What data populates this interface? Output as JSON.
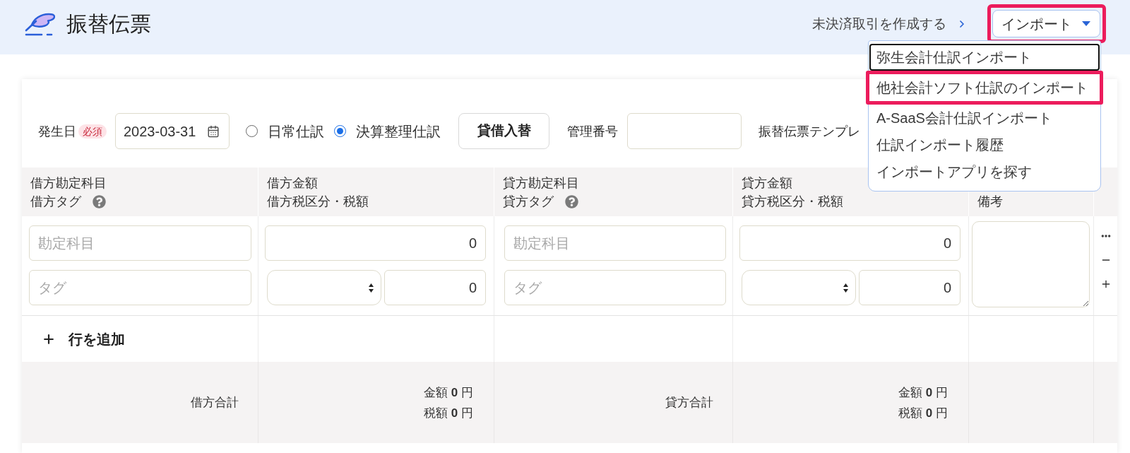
{
  "header": {
    "title": "振替伝票",
    "link": "未決済取引を作成する",
    "import_button": {
      "label": "インポート",
      "highlighted": true
    }
  },
  "import_menu": {
    "items": [
      {
        "label": "弥生会計仕訳インポート",
        "focused": true,
        "highlighted": false
      },
      {
        "label": "他社会計ソフト仕訳のインポート",
        "focused": false,
        "highlighted": true
      },
      {
        "label": "A-SaaS会計仕訳インポート",
        "focused": false,
        "highlighted": false
      },
      {
        "label": "仕訳インポート履歴",
        "focused": false,
        "highlighted": false
      },
      {
        "label": "インポートアプリを探す",
        "focused": false,
        "highlighted": false
      }
    ]
  },
  "form": {
    "date_label": "発生日",
    "required_badge": "必須",
    "date": "2023-03-31",
    "entry_types": [
      {
        "label": "日常仕訳",
        "selected": false
      },
      {
        "label": "決算整理仕訳",
        "selected": true
      }
    ],
    "swap_button": "貸借入替",
    "management_number_label": "管理番号",
    "template_label": "振替伝票テンプレ"
  },
  "table": {
    "columns": [
      {
        "lines": [
          "借方勘定科目",
          "借方タグ"
        ],
        "help": true
      },
      {
        "lines": [
          "借方金額",
          "借方税区分・税額"
        ]
      },
      {
        "lines": [
          "貸方勘定科目",
          "貸方タグ"
        ],
        "help": true
      },
      {
        "lines": [
          "貸方金額",
          "貸方税区分・税額"
        ]
      },
      {
        "lines": [
          "備考"
        ]
      }
    ],
    "row": {
      "sides": [
        {
          "account_placeholder": "勘定科目",
          "tag_placeholder": "タグ",
          "amount": "0",
          "tax": "0"
        },
        {
          "account_placeholder": "勘定科目",
          "tag_placeholder": "タグ",
          "amount": "0",
          "tax": "0"
        }
      ]
    },
    "add_row": "行を追加",
    "totals": [
      {
        "label": "借方合計",
        "amount": "金額 **0** 円",
        "tax": "税額 **0** 円"
      },
      {
        "label": "貸方合計",
        "amount": "金額 **0** 円",
        "tax": "税額 **0** 円"
      }
    ]
  }
}
